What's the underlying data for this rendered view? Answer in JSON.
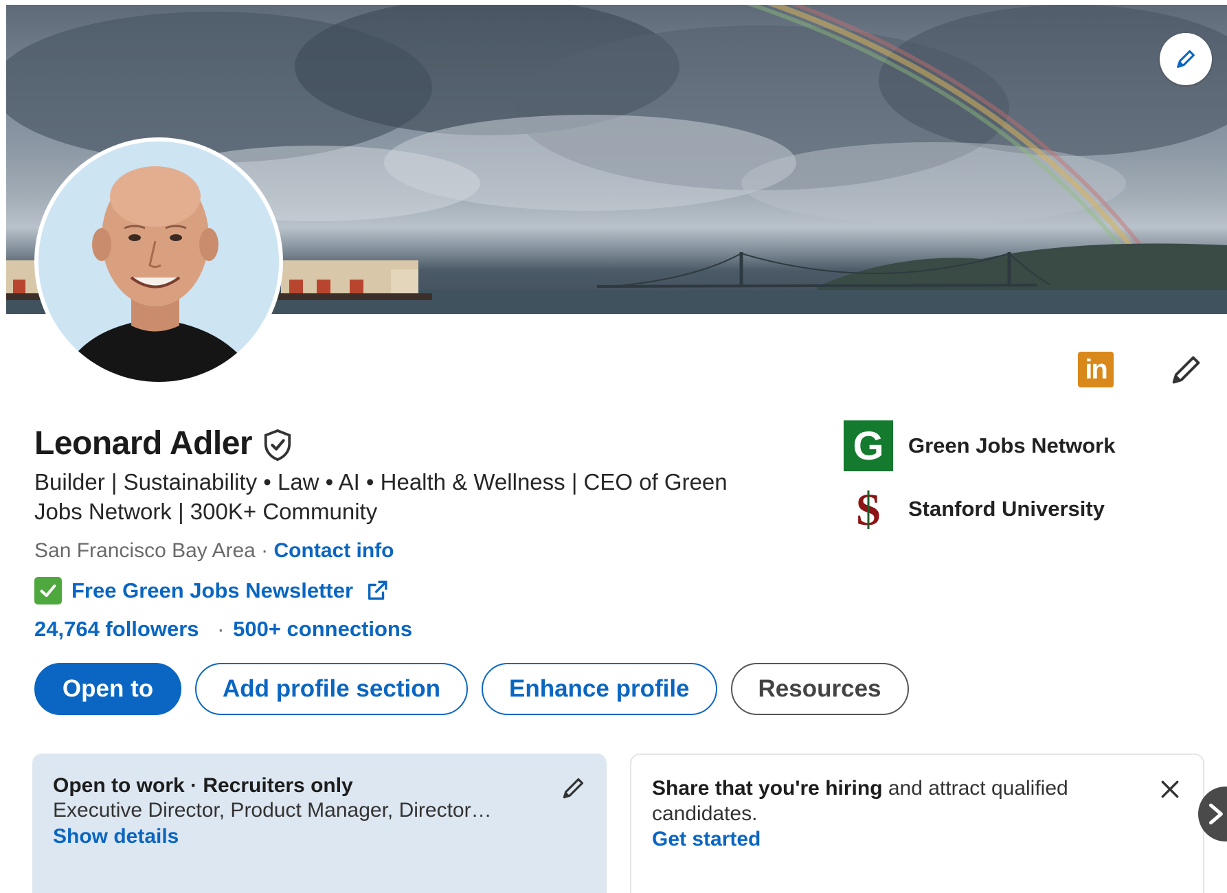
{
  "profile": {
    "name": "Leonard Adler",
    "headline": "Builder | Sustainability • Law • AI • Health & Wellness | CEO of Green Jobs Network | 300K+ Community",
    "location": "San Francisco Bay Area",
    "location_separator": "·",
    "contact_info_label": "Contact info",
    "newsletter_label": "Free Green Jobs Newsletter",
    "followers": "24,764 followers",
    "stats_separator": "·",
    "connections": "500+ connections"
  },
  "organizations": [
    {
      "name": "Green Jobs Network",
      "logo_letter": "G",
      "logo_color": "#137a2e"
    },
    {
      "name": "Stanford University",
      "logo_letter": "S",
      "logo_color": "#8c1515"
    }
  ],
  "actions": {
    "open_to": "Open to",
    "add_section": "Add profile section",
    "enhance": "Enhance profile",
    "resources": "Resources"
  },
  "open_to_work_card": {
    "title": "Open to work · Recruiters only",
    "roles": "Executive Director, Product Manager, Director…",
    "link": "Show details"
  },
  "hiring_card": {
    "bold_text": "Share that you're hiring",
    "text": " and attract qualified candidates.",
    "link": "Get started"
  },
  "icons": {
    "banner_edit": "pencil-icon",
    "verified": "shield-check-icon",
    "newsletter_check": "check-box-icon",
    "external_link": "external-link-icon",
    "linkedin": "linkedin-icon",
    "profile_edit": "pencil-icon",
    "close": "close-icon",
    "carousel_next": "chevron-right-icon"
  },
  "colors": {
    "accent": "#0a66c2",
    "open_to_work_bg": "#dde7f1",
    "linkedin_badge": "#d9891b",
    "check": "#4fa83d"
  }
}
